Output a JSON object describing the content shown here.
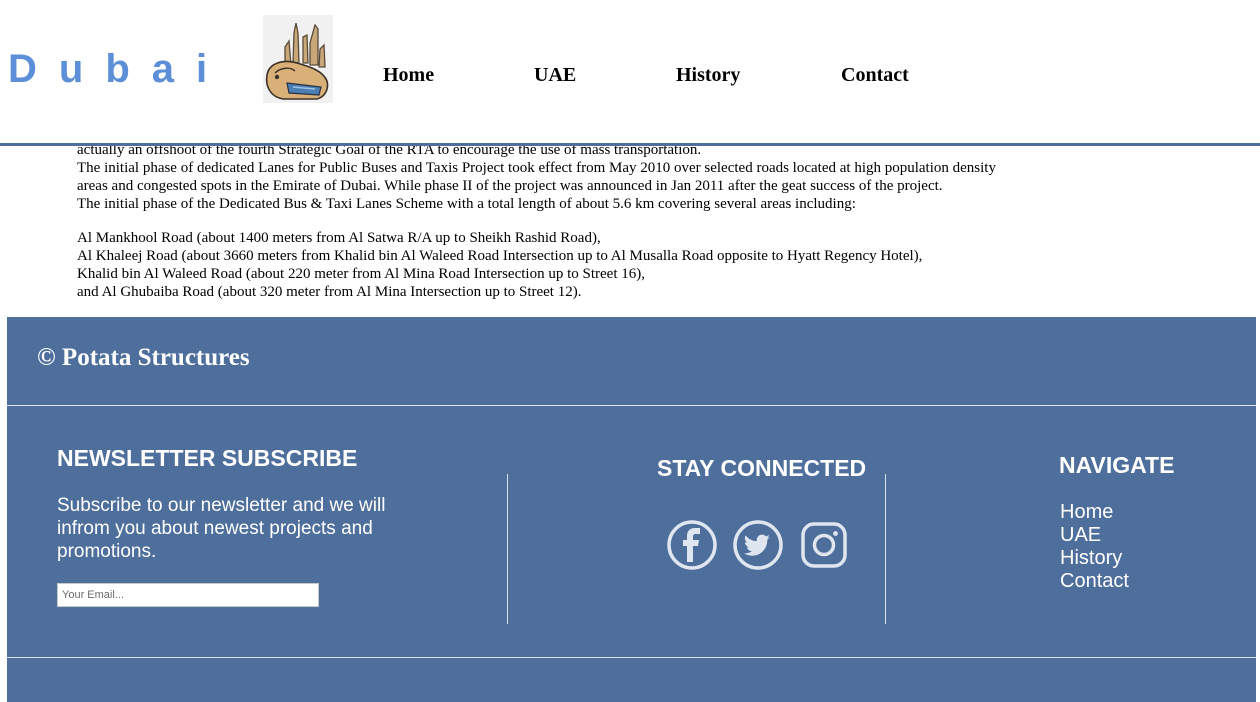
{
  "header": {
    "site_title": "Dubai",
    "nav": [
      {
        "label": "Home"
      },
      {
        "label": "UAE"
      },
      {
        "label": "History"
      },
      {
        "label": "Contact"
      }
    ]
  },
  "article": {
    "lines_top": [
      "actually an offshoot of the fourth Strategic Goal of the RTA to encourage the use of mass transportation.",
      "The initial phase of dedicated Lanes for Public Buses and Taxis Project took effect from May 2010 over selected roads located at high population density",
      "areas and congested spots in the Emirate of Dubai. While phase II of the project was announced in Jan 2011 after the geat success of the project.",
      "The initial phase of the Dedicated Bus & Taxi Lanes Scheme with a total length of about 5.6 km covering several areas including:"
    ],
    "lines_bottom": [
      "Al Mankhool Road (about 1400 meters from Al Satwa R/A up to Sheikh Rashid Road),",
      "Al Khaleej Road (about 3660 meters from Khalid bin Al Waleed Road Intersection up to Al Musalla Road opposite to Hyatt Regency Hotel),",
      "Khalid bin Al Waleed Road (about 220 meter from Al Mina Road Intersection up to Street 16),",
      "and Al Ghubaiba Road (about 320 meter from Al Mina Intersection up to Street 12)."
    ]
  },
  "footer": {
    "copyright": "© Potata Structures",
    "newsletter": {
      "title": "NEWSLETTER SUBSCRIBE",
      "text": "Subscribe to our newsletter and we will infrom you about newest projects and promotions.",
      "email_placeholder": "Your Email..."
    },
    "connect": {
      "title": "STAY CONNECTED",
      "icons": [
        "facebook-icon",
        "twitter-icon",
        "instagram-icon"
      ]
    },
    "navigate": {
      "title": "NAVIGATE",
      "links": [
        "Home",
        "UAE",
        "History",
        "Contact"
      ]
    }
  },
  "colors": {
    "brand_blue": "#5c8fd8",
    "footer_bg": "#4e6e9c",
    "header_rule": "#4e6e9c"
  }
}
